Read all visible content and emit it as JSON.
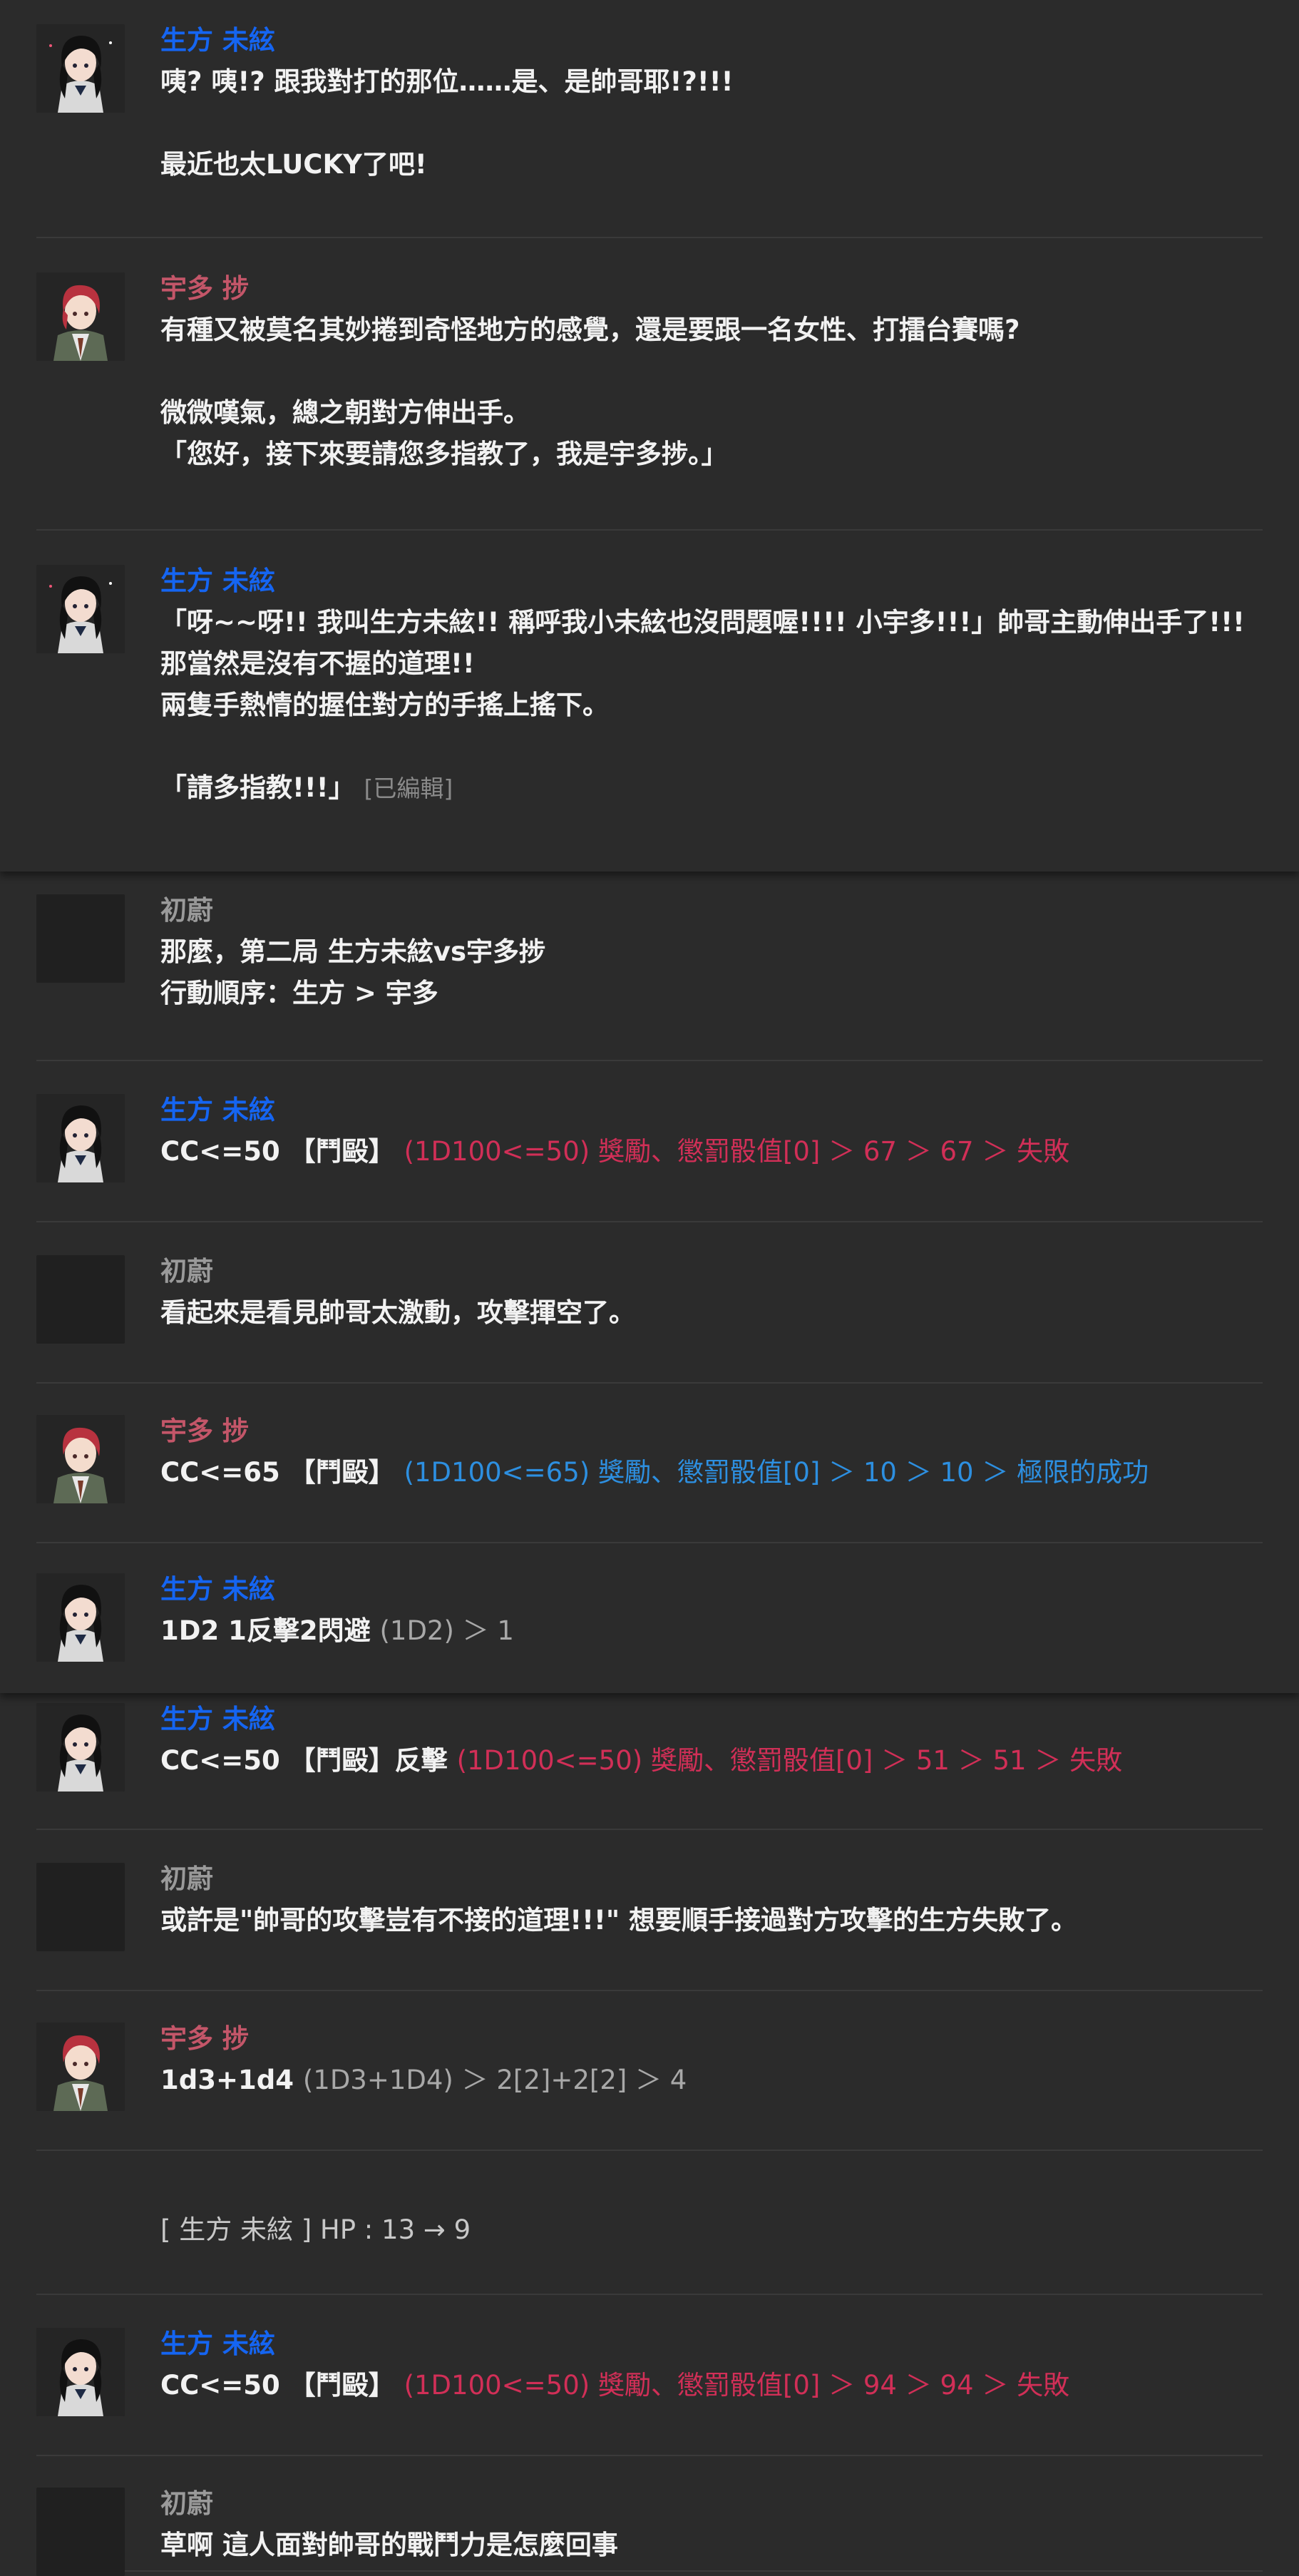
{
  "characters": {
    "ubukata": "生方 未絃",
    "uta": "宇多 捗",
    "gm": "初蔚"
  },
  "colors": {
    "ubukata_name": "#1565f2",
    "uta_name": "#c45669",
    "gm_name": "#9a9a9a",
    "fail_roll": "#d12f57",
    "success_roll": "#2d8fe0"
  },
  "messages": [
    {
      "speaker": "生方 未絃",
      "text": "咦? 咦!? 跟我對打的那位……是、是帥哥耶!?!!!\n\n最近也太LUCKY了吧!"
    },
    {
      "speaker": "宇多 捗",
      "text": "有種又被莫名其妙捲到奇怪地方的感覺，還是要跟一名女性、打擂台賽嗎?\n\n微微嘆氣，總之朝對方伸出手。\n「您好，接下來要請您多指教了，我是宇多捗。」"
    },
    {
      "speaker": "生方 未絃",
      "text": "「呀~~呀!! 我叫生方未絃!! 稱呼我小未絃也沒問題喔!!!! 小宇多!!!」帥哥主動伸出手了!!! 那當然是沒有不握的道理!!\n兩隻手熱情的握住對方的手搖上搖下。\n\n「請多指教!!!」",
      "edited": "[已編輯]"
    },
    {
      "speaker": "初蔚",
      "text": "那麼，第二局 生方未絃vs宇多捗\n行動順序：生方 > 宇多"
    },
    {
      "speaker": "生方 未絃",
      "command": "CC<=50 【鬥毆】",
      "roll": "(1D100<=50) 獎勵、懲罰骰值[0] ＞ 67 ＞ 67 ＞ 失敗"
    },
    {
      "speaker": "初蔚",
      "text": "看起來是看見帥哥太激動，攻擊揮空了。"
    },
    {
      "speaker": "宇多 捗",
      "command": "CC<=65 【鬥毆】",
      "roll": "(1D100<=65) 獎勵、懲罰骰值[0] ＞ 10 ＞ 10 ＞ 極限的成功"
    },
    {
      "speaker": "生方 未絃",
      "command": "1D2 1反擊2閃避",
      "roll": "(1D2) ＞ 1"
    },
    {
      "speaker": "生方 未絃",
      "command": "CC<=50 【鬥毆】反擊",
      "roll": "(1D100<=50) 獎勵、懲罰骰值[0] ＞ 51 ＞ 51 ＞ 失敗"
    },
    {
      "speaker": "初蔚",
      "text": "或許是\"帥哥的攻擊豈有不接的道理!!!\" 想要順手接過對方攻擊的生方失敗了。"
    },
    {
      "speaker": "宇多 捗",
      "command": "1d3+1d4",
      "roll": "(1D3+1D4) ＞ 2[2]+2[2] ＞ 4"
    },
    {
      "system": "[ 生方 未絃 ] HP : 13 → 9"
    },
    {
      "speaker": "生方 未絃",
      "command": "CC<=50 【鬥毆】",
      "roll": "(1D100<=50) 獎勵、懲罰骰值[0] ＞ 94 ＞ 94 ＞ 失敗"
    },
    {
      "speaker": "初蔚",
      "text": "草啊 這人面對帥哥的戰鬥力是怎麼回事"
    }
  ]
}
